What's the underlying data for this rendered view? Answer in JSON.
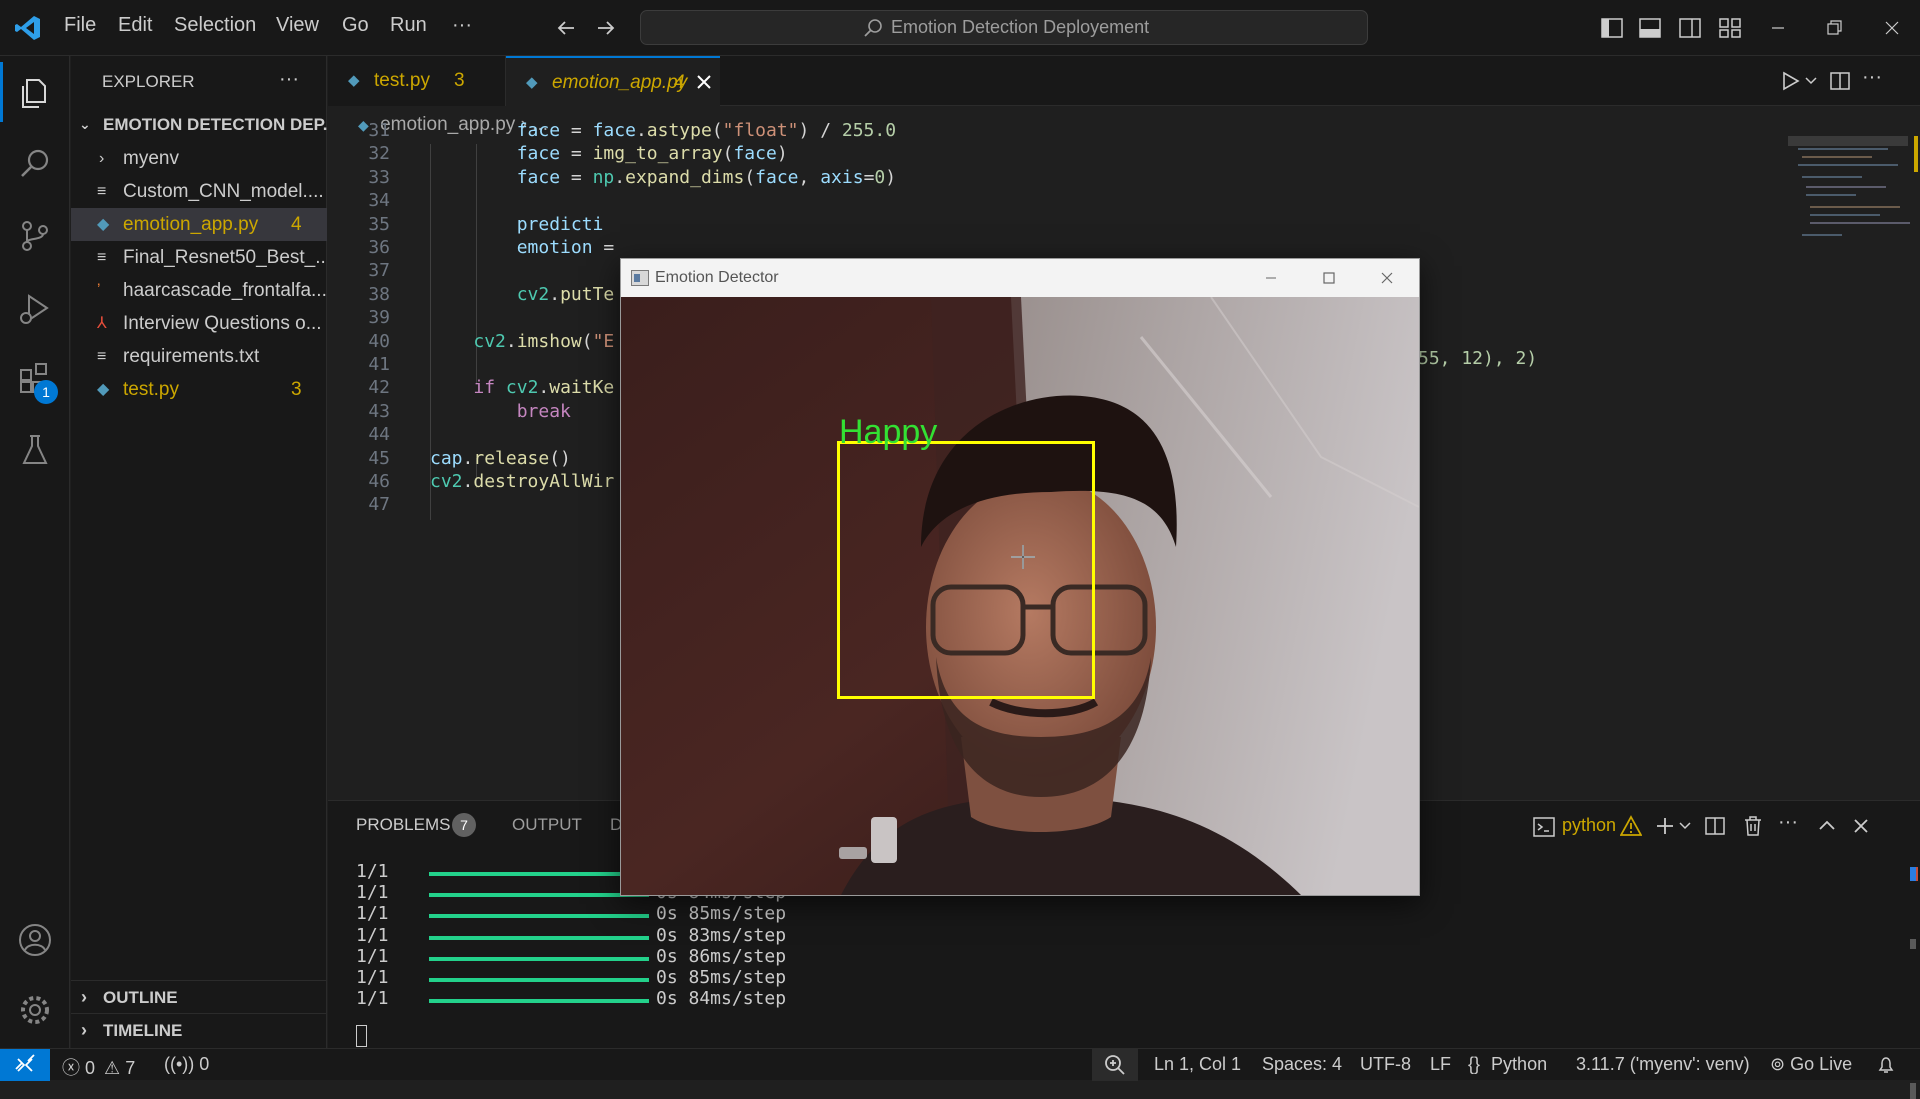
{
  "window": {
    "search": "Emotion Detection Deployement"
  },
  "menu": [
    "File",
    "Edit",
    "Selection",
    "View",
    "Go",
    "Run",
    "···"
  ],
  "activity_bar": {
    "extensions_badge": "1"
  },
  "sidebar": {
    "title": "EXPLORER",
    "more": "···",
    "folder": "EMOTION DETECTION DEP...",
    "items": [
      {
        "label": "myenv",
        "type": "folder",
        "badge": ""
      },
      {
        "label": "Custom_CNN_model....",
        "type": "file",
        "badge": ""
      },
      {
        "label": "emotion_app.py",
        "type": "python",
        "badge": "4"
      },
      {
        "label": "Final_Resnet50_Best_...",
        "type": "file",
        "badge": ""
      },
      {
        "label": "haarcascade_frontalfa...",
        "type": "rss",
        "badge": ""
      },
      {
        "label": "Interview Questions o...",
        "type": "pdf",
        "badge": ""
      },
      {
        "label": "requirements.txt",
        "type": "file",
        "badge": ""
      },
      {
        "label": "test.py",
        "type": "python",
        "badge": "3"
      }
    ],
    "outline": "OUTLINE",
    "timeline": "TIMELINE"
  },
  "tabs": [
    {
      "label": "test.py",
      "badge": "3"
    },
    {
      "label": "emotion_app.py",
      "badge": "4"
    }
  ],
  "breadcrumb": {
    "file": "emotion_app.py",
    "more": "..."
  },
  "code_lines": [
    {
      "n": "31",
      "text": "        face = face.astype(\"float\") / 255.0"
    },
    {
      "n": "32",
      "text": "        face = img_to_array(face)"
    },
    {
      "n": "33",
      "text": "        face = np.expand_dims(face, axis=0)"
    },
    {
      "n": "34",
      "text": ""
    },
    {
      "n": "35",
      "text": "        predicti"
    },
    {
      "n": "36",
      "text": "        emotion ="
    },
    {
      "n": "37",
      "text": ""
    },
    {
      "n": "38",
      "text": "        cv2.putTe"
    },
    {
      "n": "39",
      "text": ""
    },
    {
      "n": "40",
      "text": "    cv2.imshow(\"E"
    },
    {
      "n": "41",
      "text": ""
    },
    {
      "n": "42",
      "text": "    if cv2.waitKe"
    },
    {
      "n": "43",
      "text": "        break"
    },
    {
      "n": "44",
      "text": ""
    },
    {
      "n": "45",
      "text": "cap.release()"
    },
    {
      "n": "46",
      "text": "cv2.destroyAllWir"
    },
    {
      "n": "47",
      "text": ""
    }
  ],
  "line38_tail": "55, 12), 2)",
  "panel": {
    "problems": "PROBLEMS",
    "problems_count": "7",
    "output": "OUTPUT",
    "debug": "D",
    "terminal_name": "python",
    "lines": [
      {
        "step": "1/1",
        "time": ""
      },
      {
        "step": "1/1",
        "time": "0s 84ms/step"
      },
      {
        "step": "1/1",
        "time": "0s 85ms/step"
      },
      {
        "step": "1/1",
        "time": "0s 83ms/step"
      },
      {
        "step": "1/1",
        "time": "0s 86ms/step"
      },
      {
        "step": "1/1",
        "time": "0s 85ms/step"
      },
      {
        "step": "1/1",
        "time": "0s 84ms/step"
      }
    ]
  },
  "opencv_window": {
    "title": "Emotion Detector",
    "label": "Happy",
    "label_color": "#33e033",
    "box_color": "#ffff00"
  },
  "statusbar": {
    "errors": "0",
    "warnings": "7",
    "ports": "0",
    "position": "Ln 1, Col 1",
    "spaces": "Spaces: 4",
    "encoding": "UTF-8",
    "eol": "LF",
    "language": "Python",
    "interpreter": "3.11.7 ('myenv': venv)",
    "golive": "Go Live"
  },
  "colors": {
    "accent": "#0078d4",
    "python_icon": "#519aba",
    "warning": "#cca700",
    "progress": "#23d18b"
  }
}
